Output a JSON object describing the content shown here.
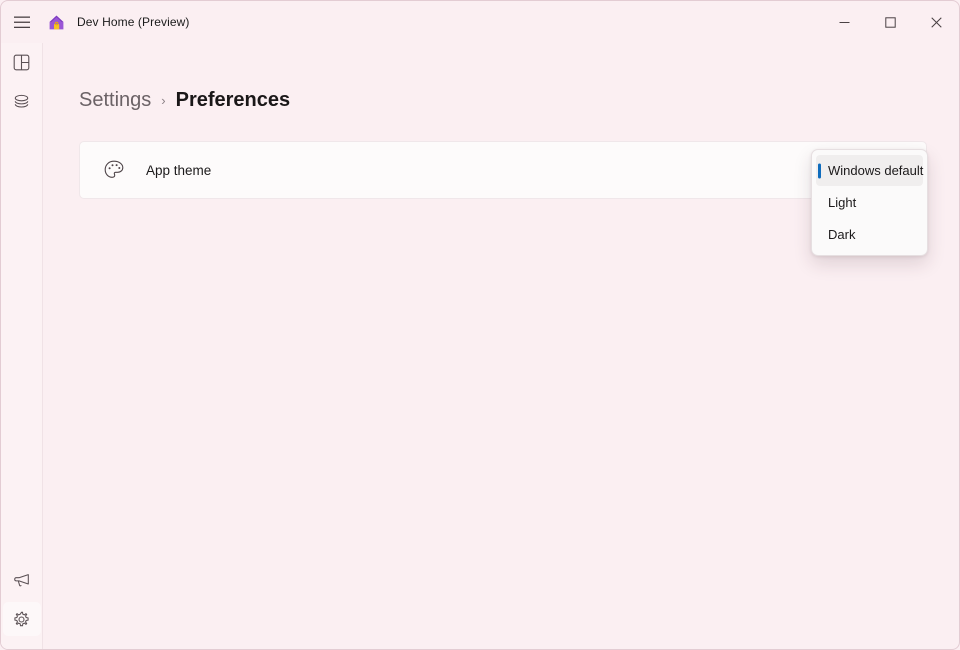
{
  "window": {
    "title": "Dev Home (Preview)",
    "app_icon": "dev-home-house-icon",
    "hamburger_icon": "hamburger-menu-icon",
    "controls": {
      "minimize": "minimize-icon",
      "maximize": "maximize-icon",
      "close": "close-icon"
    },
    "colors": {
      "background": "#fbeff2",
      "nav_rail": "#fcf2f4",
      "card": "#fdfbfb",
      "accent": "#0f6cbd",
      "flyout": "#fbfafa"
    }
  },
  "navrail": {
    "top_items": [
      {
        "name": "dashboard",
        "icon": "dashboard-layout-icon",
        "selected": false
      },
      {
        "name": "environments",
        "icon": "layers-stack-icon",
        "selected": false
      }
    ],
    "bottom_items": [
      {
        "name": "feedback",
        "icon": "megaphone-icon",
        "selected": false
      },
      {
        "name": "settings",
        "icon": "gear-icon",
        "selected": true
      }
    ]
  },
  "breadcrumb": {
    "parent": "Settings",
    "separator": "›",
    "current": "Preferences"
  },
  "settings": {
    "app_theme": {
      "icon": "paint-palette-icon",
      "label": "App theme",
      "selected_value": "Windows default"
    }
  },
  "theme_dropdown": {
    "open": true,
    "options": [
      {
        "label": "Windows default",
        "selected": true
      },
      {
        "label": "Light",
        "selected": false
      },
      {
        "label": "Dark",
        "selected": false
      }
    ]
  }
}
